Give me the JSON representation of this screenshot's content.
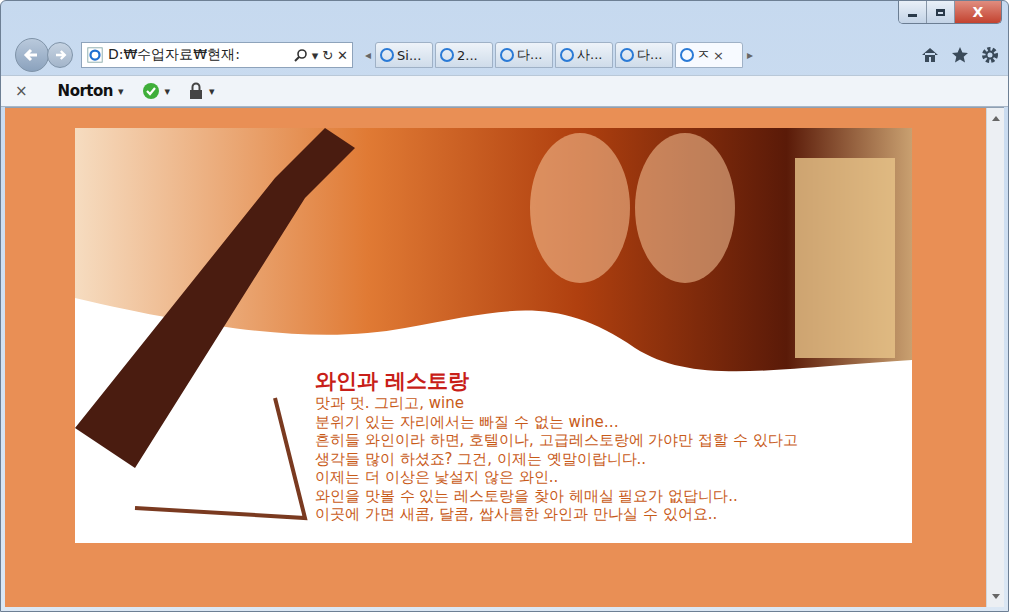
{
  "window": {
    "close_glyph": "X"
  },
  "address_bar": {
    "text": "D:₩수업자료₩현재:",
    "dropdown": "▾",
    "refresh": "↻",
    "stop": "✕"
  },
  "tab_scroll": {
    "left": "◂",
    "right": "▸"
  },
  "tabs": [
    {
      "label": "Si...",
      "selected": false
    },
    {
      "label": "2...",
      "selected": false
    },
    {
      "label": "다...",
      "selected": false
    },
    {
      "label": "사...",
      "selected": false
    },
    {
      "label": "다...",
      "selected": false
    },
    {
      "label": "ㅈ",
      "selected": true,
      "close": "×"
    }
  ],
  "toolbar": {
    "close": "×",
    "items": [
      {
        "kind": "brand",
        "label": "Norton",
        "arrow": "▾"
      },
      {
        "kind": "check",
        "arrow": "▾"
      },
      {
        "kind": "lock",
        "arrow": "▾"
      }
    ]
  },
  "page": {
    "heading": "와인과 레스토랑",
    "lines": [
      "맛과 멋. 그리고, wine",
      "분위기 있는 자리에서는 빠질 수 없는 wine…",
      "흔히들 와인이라 하면, 호텔이나, 고급레스토랑에 가야만 접할 수 있다고",
      "생각들 많이 하셨죠? 그건, 이제는 옛말이랍니다..",
      "이제는 더 이상은 낯설지 않은 와인..",
      "와인을 맛볼 수 있는 레스토랑을 찾아 헤매실 필요가 없답니다..",
      "이곳에 가면 새콤, 달콤, 쌉사름한 와인과 만나실 수 있어요.."
    ]
  }
}
